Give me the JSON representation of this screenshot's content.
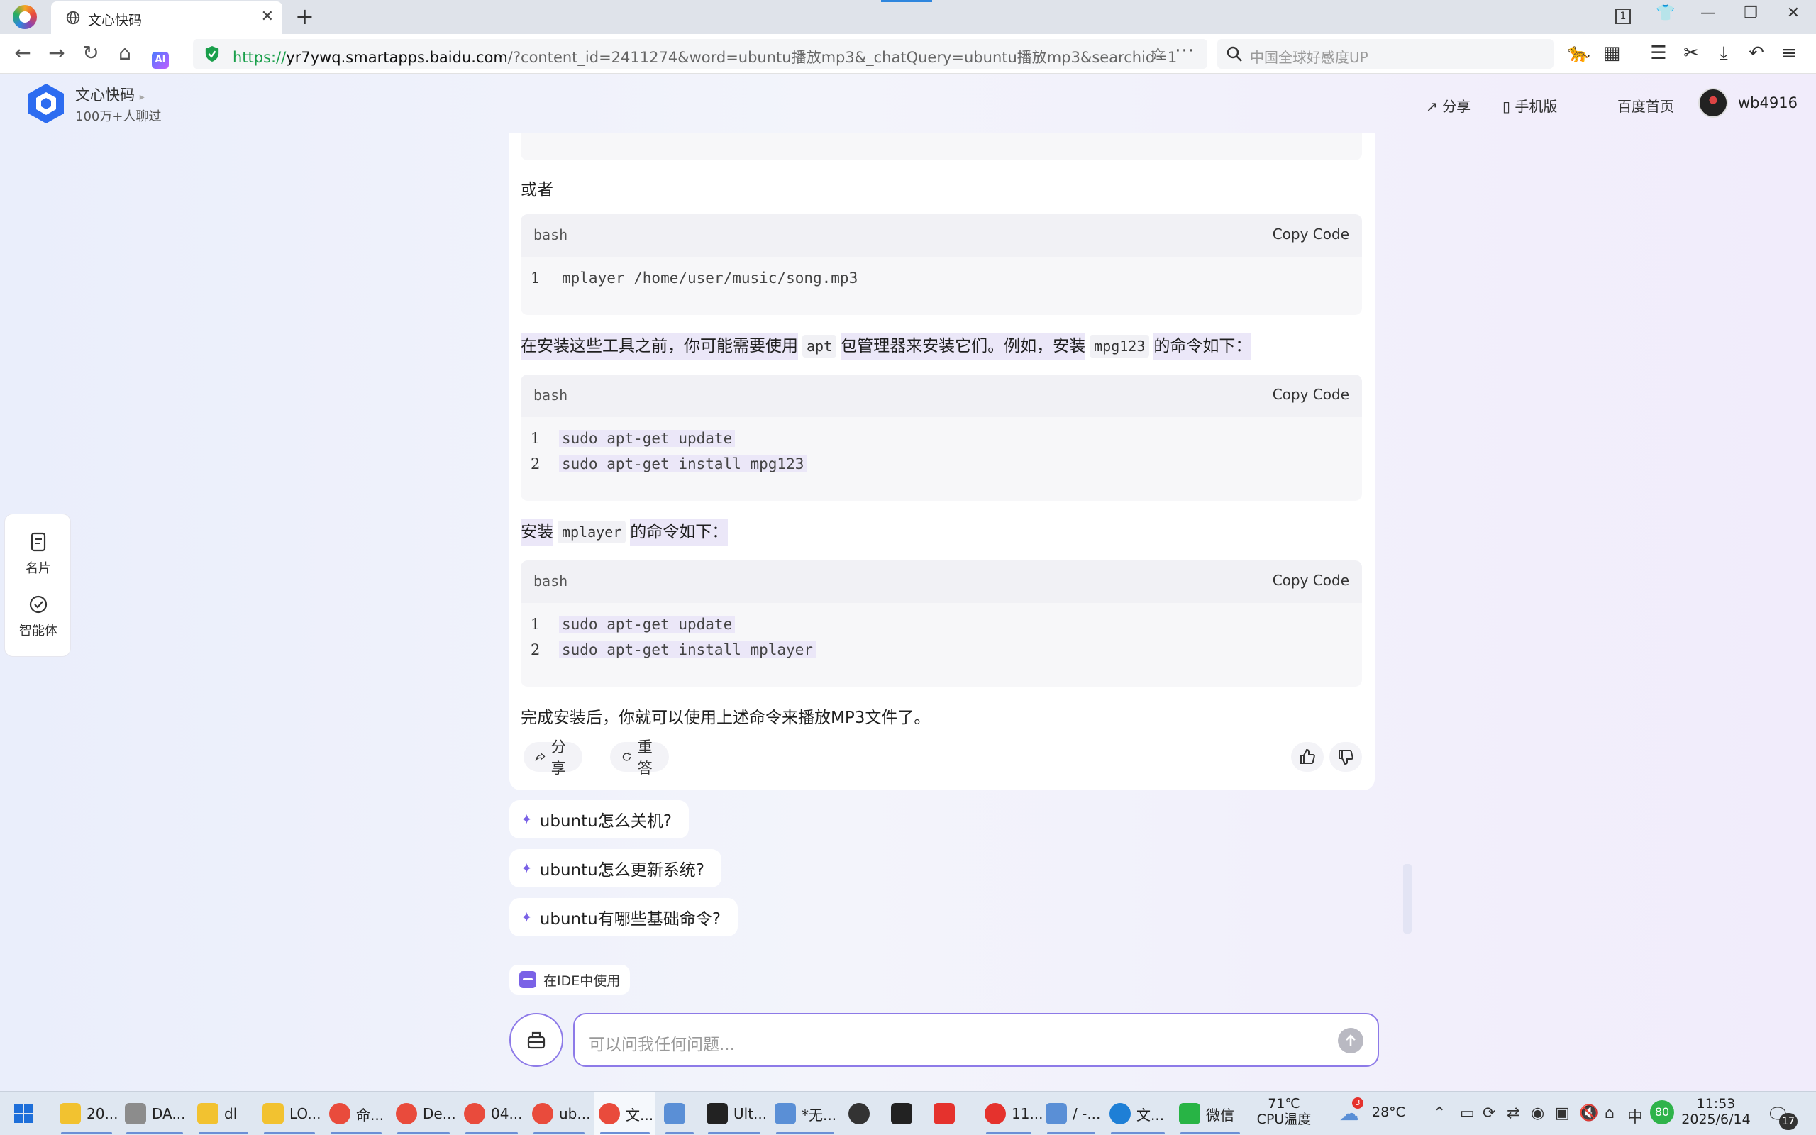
{
  "browser": {
    "tab_title": "文心快码",
    "url": {
      "protocol": "https://",
      "host": "yr7ywq.smartapps.baidu.com",
      "rest": "/?content_id=2411274&word=ubuntu播放mp3&_chatQuery=ubuntu播放mp3&searchid=1"
    },
    "search_placeholder": "中国全球好感度UP",
    "tab_count_badge": "1"
  },
  "site": {
    "name": "文心快码",
    "subtitle": "100万+人聊过",
    "share_label": "分享",
    "mobile_label": "手机版",
    "home_label": "百度首页",
    "username": "wb4916"
  },
  "side_panel": {
    "card_label": "名片",
    "agent_label": "智能体"
  },
  "answer": {
    "or_text": "或者",
    "block1": {
      "lang": "bash",
      "copy_label": "Copy Code",
      "lines": [
        {
          "num": "1",
          "code": "mplayer /home/user/music/song.mp3"
        }
      ]
    },
    "para1": {
      "a": "在安装这些工具之前，你可能需要使用",
      "code1": "apt",
      "b": "包管理器来安装它们。例如，安装",
      "code2": "mpg123",
      "c": "的命令如下："
    },
    "block2": {
      "lang": "bash",
      "copy_label": "Copy Code",
      "lines": [
        {
          "num": "1",
          "code": "sudo apt-get update"
        },
        {
          "num": "2",
          "code": "sudo apt-get install mpg123"
        }
      ]
    },
    "para2": {
      "a": "安装",
      "code1": "mplayer",
      "b": "的命令如下："
    },
    "block3": {
      "lang": "bash",
      "copy_label": "Copy Code",
      "lines": [
        {
          "num": "1",
          "code": "sudo apt-get update"
        },
        {
          "num": "2",
          "code": "sudo apt-get install mplayer"
        }
      ]
    },
    "closing": "完成安装后，你就可以使用上述命令来播放MP3文件了。",
    "share_label": "分享",
    "retry_label": "重答"
  },
  "suggestions": [
    "ubuntu怎么关机?",
    "ubuntu怎么更新系统?",
    "ubuntu有哪些基础命令?"
  ],
  "ide_label": "在IDE中使用",
  "chat": {
    "placeholder": "可以问我任何问题..."
  },
  "taskbar": {
    "items": [
      {
        "label": "20...",
        "color": "#f2c230"
      },
      {
        "label": "DA...",
        "color": "#8c8c8c"
      },
      {
        "label": "dl",
        "color": "#f2c230"
      },
      {
        "label": "LO...",
        "color": "#f2c230"
      },
      {
        "label": "命...",
        "color": "#e94b3c"
      },
      {
        "label": "De...",
        "color": "#e94b3c"
      },
      {
        "label": "04...",
        "color": "#e94b3c"
      },
      {
        "label": "ub...",
        "color": "#e94b3c"
      },
      {
        "label": "文...",
        "color": "#e94b3c"
      },
      {
        "label": "",
        "color": "#5a8fd6"
      },
      {
        "label": "Ult...",
        "color": "#222222"
      },
      {
        "label": "*无...",
        "color": "#5a8fd6"
      },
      {
        "label": "",
        "color": "#333333"
      },
      {
        "label": "",
        "color": "#222222"
      },
      {
        "label": "",
        "color": "#e5322d"
      },
      {
        "label": "11...",
        "color": "#e5322d"
      },
      {
        "label": "/ -...",
        "color": "#5a8fd6"
      },
      {
        "label": "文...",
        "color": "#1e7fd6"
      },
      {
        "label": "微信",
        "color": "#28b445"
      }
    ],
    "cpu_temp": "71℃",
    "cpu_label": "CPU温度",
    "weather_temp": "28°C",
    "weather_badge": "3",
    "battery_badge": "80",
    "time": "11:53",
    "date": "2025/6/14",
    "notif_count": "17"
  }
}
